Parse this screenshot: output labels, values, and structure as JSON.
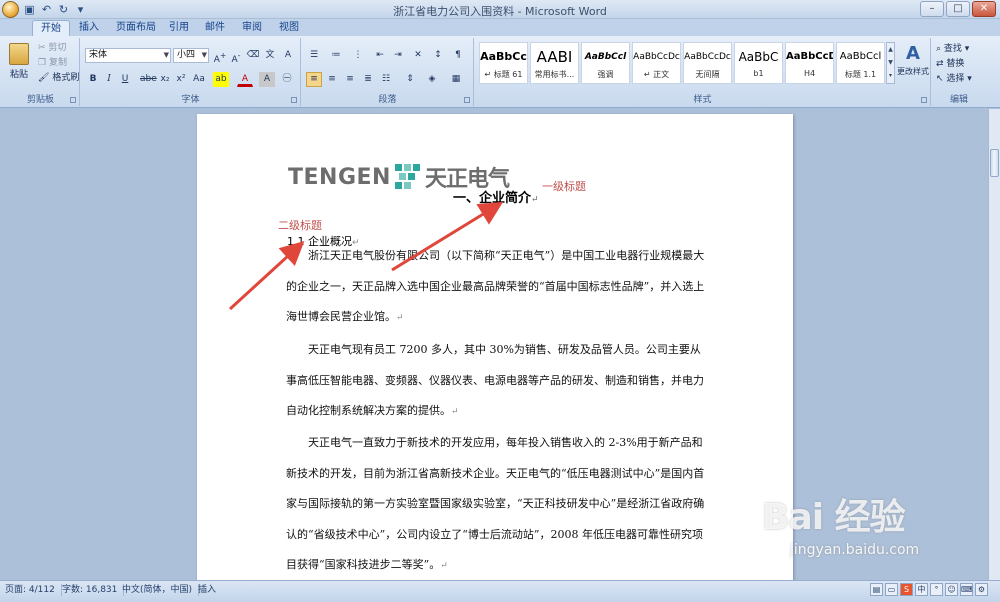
{
  "window": {
    "title": "浙江省电力公司入围资料 - Microsoft Word"
  },
  "tabs": [
    "开始",
    "插入",
    "页面布局",
    "引用",
    "邮件",
    "审阅",
    "视图"
  ],
  "ribbon": {
    "clipboard": {
      "label": "剪贴板",
      "paste": "粘贴",
      "cut": "剪切",
      "copy": "复制",
      "format_painter": "格式刷"
    },
    "font": {
      "label": "字体",
      "font_name": "宋体",
      "font_size": "小四"
    },
    "paragraph": {
      "label": "段落"
    },
    "styles": {
      "label": "样式",
      "items": [
        {
          "sample": "AaBbCc",
          "name": "↵ 标题 61"
        },
        {
          "sample": "AABI",
          "name": "常用标书..."
        },
        {
          "sample": "AaBbCcl",
          "name": "强调"
        },
        {
          "sample": "AaBbCcDc",
          "name": "↵ 正文"
        },
        {
          "sample": "AaBbCcDc",
          "name": "无间隔"
        },
        {
          "sample": "AaBbC",
          "name": "b1"
        },
        {
          "sample": "AaBbCcD",
          "name": "H4"
        },
        {
          "sample": "AaBbCcl",
          "name": "标题 1.1"
        }
      ],
      "change_styles": "更改样式"
    },
    "editing": {
      "label": "编辑",
      "find": "查找",
      "replace": "替换",
      "select": "选择"
    }
  },
  "document": {
    "logo_text": "TENGEN",
    "logo_cn": "天正电气",
    "heading1": "一、企业简介",
    "annotation_h1": "一级标题",
    "annotation_h2": "二级标题",
    "heading2": "1.1 企业概况",
    "paragraphs": [
      "　　浙江天正电气股份有限公司（以下简称“天正电气”）是中国工业电器行业规模最大的企业之一，天正品牌入选中国企业最高品牌荣誉的“首届中国标志性品牌”，并入选上海世博会民营企业馆。",
      "　　天正电气现有员工 7200 多人，其中 30%为销售、研发及品管人员。公司主要从事高低压智能电器、变频器、仪器仪表、电源电器等产品的研发、制造和销售，并电力自动化控制系统解决方案的提供。",
      "　　天正电气一直致力于新技术的开发应用，每年投入销售收入的 2-3%用于新产品和新技术的开发，目前为浙江省高新技术企业。天正电气的“低压电器测试中心”是国内首家与国际接轨的第一方实验室暨国家级实验室，“天正科技研发中心”是经浙江省政府确认的“省级技术中心”，公司内设立了“博士后流动站”，2008 年低压电器可靠性研究项目获得“国家科技进步二等奖”。"
    ]
  },
  "status": {
    "page": "页面: 4/112",
    "words": "字数: 16,831",
    "lang": "中文(简体，中国)",
    "mode": "插入"
  },
  "watermark": {
    "main": "Bai 经验",
    "sub": "jingyan.baidu.com"
  }
}
